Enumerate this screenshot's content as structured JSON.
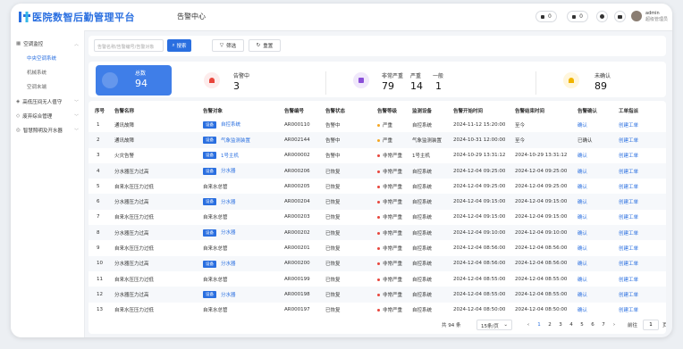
{
  "app": {
    "brand": "医院数智后勤管理平台",
    "page_title": "告警中心"
  },
  "topbar": {
    "pill1_count": "0",
    "pill2_count": "0",
    "user_name": "admin",
    "user_role": "超级管理员"
  },
  "sidebar": {
    "groups": [
      {
        "label": "空调监控",
        "expanded": true,
        "items": [
          "中央空调系统",
          "机械系统",
          "空调末端"
        ]
      },
      {
        "label": "高低压间无人值守"
      },
      {
        "label": "废弃综合管理"
      },
      {
        "label": "智慧照明及开水器"
      }
    ]
  },
  "filter": {
    "search_placeholder": "告警名称/告警编号/告警对象",
    "search_button": "搜索",
    "filter_button": "筛选",
    "reset_button": "重置"
  },
  "stats": {
    "total_label": "总数",
    "total_value": "94",
    "alarming_label": "告警中",
    "alarming_value": "3",
    "very_severe_label": "非常严重",
    "very_severe_value": "79",
    "severe_label": "严重",
    "severe_value": "14",
    "normal_label": "一般",
    "normal_value": "1",
    "unconfirmed_label": "未确认",
    "unconfirmed_value": "89"
  },
  "table": {
    "headers": [
      "序号",
      "告警名称",
      "告警对象",
      "告警编号",
      "告警状态",
      "告警等级",
      "监测设备",
      "告警开始时间",
      "告警结束时间",
      "告警确认",
      "工单指派"
    ],
    "rows": [
      [
        "1",
        "通讯故障",
        "设备",
        "自控系统",
        "AR000110",
        "告警中",
        "严重",
        "自控系统",
        "2024-11-12 15:20:00",
        "至今",
        "确认",
        "创建工单"
      ],
      [
        "2",
        "通讯故障",
        "设备",
        "气象监测装置",
        "AR002144",
        "告警中",
        "严重",
        "气象监测装置",
        "2024-10-31 12:00:00",
        "至今",
        "已确认",
        "创建工单"
      ],
      [
        "3",
        "火灾告警",
        "设备",
        "1号主机",
        "AR000002",
        "告警中",
        "非常严重",
        "1号主机",
        "2024-10-29 13:31:12",
        "2024-10-29 13:31:12",
        "确认",
        "创建工单"
      ],
      [
        "4",
        "分水器压力过高",
        "设备",
        "分水器",
        "AR000206",
        "已恢复",
        "非常严重",
        "自控系统",
        "2024-12-04 09:25:00",
        "2024-12-04 09:25:00",
        "确认",
        "创建工单"
      ],
      [
        "5",
        "自来水压压力过低",
        "",
        "自来水总管",
        "AR000205",
        "已恢复",
        "非常严重",
        "自控系统",
        "2024-12-04 09:25:00",
        "2024-12-04 09:25:00",
        "确认",
        "创建工单"
      ],
      [
        "6",
        "分水器压力过高",
        "设备",
        "分水器",
        "AR000204",
        "已恢复",
        "非常严重",
        "自控系统",
        "2024-12-04 09:15:00",
        "2024-12-04 09:15:00",
        "确认",
        "创建工单"
      ],
      [
        "7",
        "自来水压压力过低",
        "",
        "自来水总管",
        "AR000203",
        "已恢复",
        "非常严重",
        "自控系统",
        "2024-12-04 09:15:00",
        "2024-12-04 09:15:00",
        "确认",
        "创建工单"
      ],
      [
        "8",
        "分水器压力过高",
        "设备",
        "分水器",
        "AR000202",
        "已恢复",
        "非常严重",
        "自控系统",
        "2024-12-04 09:10:00",
        "2024-12-04 09:10:00",
        "确认",
        "创建工单"
      ],
      [
        "9",
        "自来水压压力过低",
        "",
        "自来水总管",
        "AR000201",
        "已恢复",
        "非常严重",
        "自控系统",
        "2024-12-04 08:56:00",
        "2024-12-04 08:56:00",
        "确认",
        "创建工单"
      ],
      [
        "10",
        "分水器压力过高",
        "设备",
        "分水器",
        "AR000200",
        "已恢复",
        "非常严重",
        "自控系统",
        "2024-12-04 08:56:00",
        "2024-12-04 08:56:00",
        "确认",
        "创建工单"
      ],
      [
        "11",
        "自来水压压力过低",
        "",
        "自来水总管",
        "AR000199",
        "已恢复",
        "非常严重",
        "自控系统",
        "2024-12-04 08:55:00",
        "2024-12-04 08:55:00",
        "确认",
        "创建工单"
      ],
      [
        "12",
        "分水器压力过高",
        "设备",
        "分水器",
        "AR000198",
        "已恢复",
        "非常严重",
        "自控系统",
        "2024-12-04 08:55:00",
        "2024-12-04 08:55:00",
        "确认",
        "创建工单"
      ],
      [
        "13",
        "自来水压压力过低",
        "",
        "自来水总管",
        "AR000197",
        "已恢复",
        "非常严重",
        "自控系统",
        "2024-12-04 08:50:00",
        "2024-12-04 08:50:00",
        "确认",
        "创建工单"
      ]
    ]
  },
  "pagination": {
    "total_text": "共 94 条",
    "page_size": "15条/页",
    "pages": [
      "1",
      "2",
      "3",
      "4",
      "5",
      "6",
      "7"
    ],
    "current_page": "1",
    "goto_label": "前往",
    "goto_value": "1",
    "page_unit": "页"
  },
  "colors": {
    "accent": "#2a6fe0",
    "severe": "#f5a623",
    "very_severe": "#e8453c"
  }
}
